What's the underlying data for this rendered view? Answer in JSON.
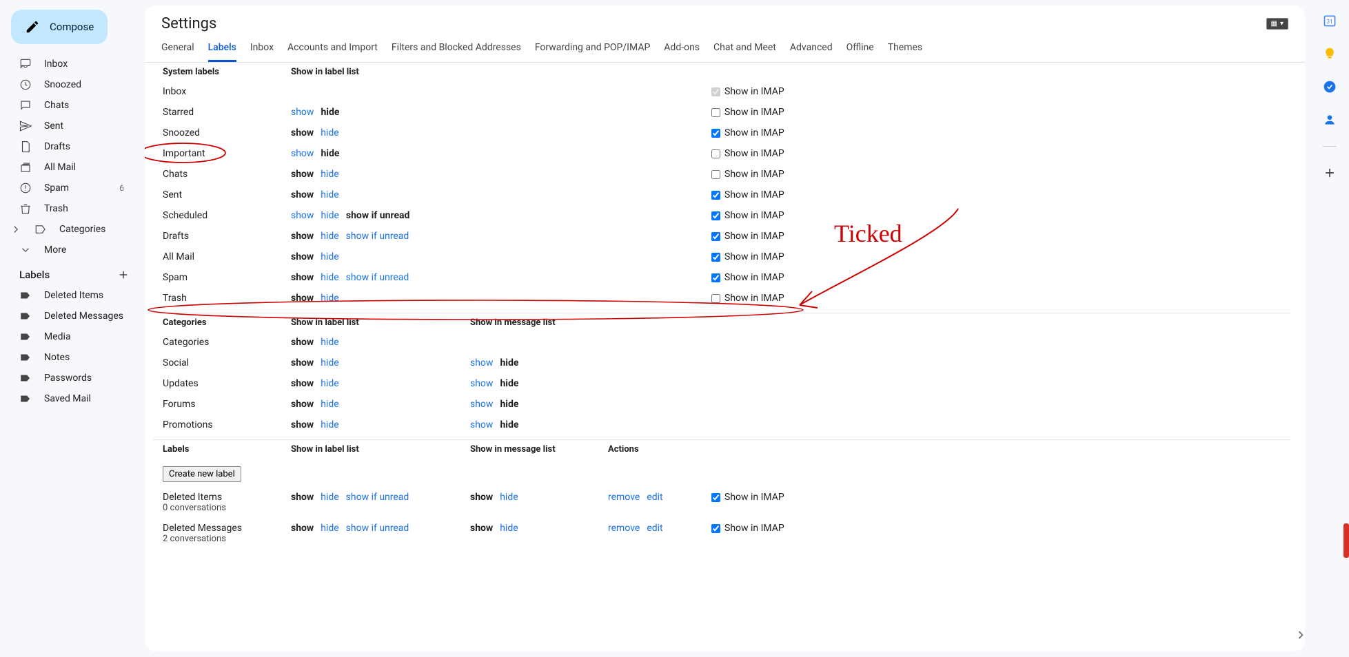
{
  "compose": "Compose",
  "nav": {
    "inbox": "Inbox",
    "snoozed": "Snoozed",
    "chats": "Chats",
    "sent": "Sent",
    "drafts": "Drafts",
    "allmail": "All Mail",
    "spam": "Spam",
    "spam_count": "6",
    "trash": "Trash",
    "categories": "Categories",
    "more": "More"
  },
  "labels_header": "Labels",
  "user_labels": [
    "Deleted Items",
    "Deleted Messages",
    "Media",
    "Notes",
    "Passwords",
    "Saved Mail"
  ],
  "title": "Settings",
  "tabs": [
    "General",
    "Labels",
    "Inbox",
    "Accounts and Import",
    "Filters and Blocked Addresses",
    "Forwarding and POP/IMAP",
    "Add-ons",
    "Chat and Meet",
    "Advanced",
    "Offline",
    "Themes"
  ],
  "active_tab": 1,
  "headers": {
    "system": "System labels",
    "show_list": "Show in label list",
    "categories": "Categories",
    "show_msg": "Show in message list",
    "labels": "Labels",
    "actions": "Actions"
  },
  "opt_show": "show",
  "opt_hide": "hide",
  "opt_unread": "show if unread",
  "imap_label": "Show in IMAP",
  "action_remove": "remove",
  "action_edit": "edit",
  "create_label": "Create new label",
  "system_rows": [
    {
      "name": "Inbox",
      "show": null,
      "hide": null,
      "unread": null,
      "imap": true,
      "imap_disabled": true
    },
    {
      "name": "Starred",
      "show": "unsel",
      "hide": "sel",
      "unread": null,
      "imap": false
    },
    {
      "name": "Snoozed",
      "show": "sel",
      "hide": "unsel",
      "unread": null,
      "imap": true
    },
    {
      "name": "Important",
      "show": "unsel",
      "hide": "sel",
      "unread": null,
      "imap": false
    },
    {
      "name": "Chats",
      "show": "sel",
      "hide": "unsel",
      "unread": null,
      "imap": false
    },
    {
      "name": "Sent",
      "show": "sel",
      "hide": "unsel",
      "unread": null,
      "imap": true
    },
    {
      "name": "Scheduled",
      "show": "unsel",
      "hide": "unsel",
      "unread": "sel",
      "imap": true
    },
    {
      "name": "Drafts",
      "show": "sel",
      "hide": "unsel",
      "unread": "unsel",
      "imap": true
    },
    {
      "name": "All Mail",
      "show": "sel",
      "hide": "unsel",
      "unread": null,
      "imap": true
    },
    {
      "name": "Spam",
      "show": "sel",
      "hide": "unsel",
      "unread": "unsel",
      "imap": true
    },
    {
      "name": "Trash",
      "show": "sel",
      "hide": "unsel",
      "unread": null,
      "imap": false
    }
  ],
  "cat_rows": [
    {
      "name": "Categories",
      "show": "sel",
      "hide": "unsel",
      "msg_show": null,
      "msg_hide": null
    },
    {
      "name": "Social",
      "show": "sel",
      "hide": "unsel",
      "msg_show": "unsel",
      "msg_hide": "sel"
    },
    {
      "name": "Updates",
      "show": "sel",
      "hide": "unsel",
      "msg_show": "unsel",
      "msg_hide": "sel"
    },
    {
      "name": "Forums",
      "show": "sel",
      "hide": "unsel",
      "msg_show": "unsel",
      "msg_hide": "sel"
    },
    {
      "name": "Promotions",
      "show": "sel",
      "hide": "unsel",
      "msg_show": "unsel",
      "msg_hide": "sel"
    }
  ],
  "label_rows": [
    {
      "name": "Deleted Items",
      "sub": "0 conversations",
      "show": "sel",
      "hide": "unsel",
      "unread": "unsel",
      "msg_show": "sel",
      "msg_hide": "unsel",
      "imap": true
    },
    {
      "name": "Deleted Messages",
      "sub": "2 conversations",
      "show": "sel",
      "hide": "unsel",
      "unread": "unsel",
      "msg_show": "sel",
      "msg_hide": "unsel",
      "imap": true
    }
  ],
  "annotation": "Ticked"
}
